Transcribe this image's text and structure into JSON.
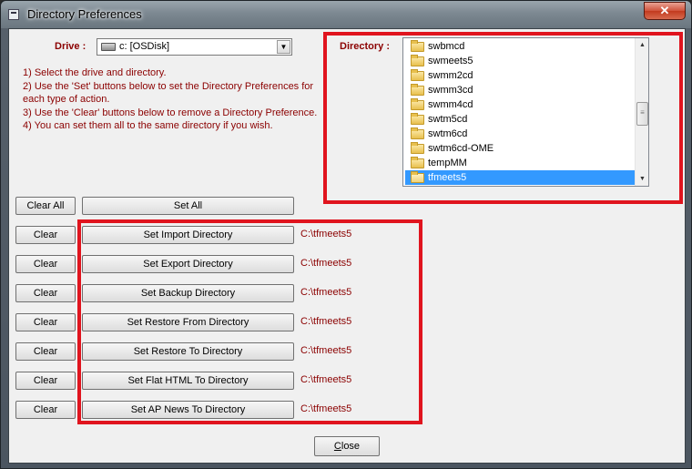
{
  "window": {
    "title": "Directory Preferences",
    "close_glyph": "✕"
  },
  "drive": {
    "label": "Drive :",
    "value": "c: [OSDisk]",
    "icon": "hard-drive-icon"
  },
  "instructions": [
    "1) Select the drive and directory.",
    "2) Use the 'Set' buttons below to set the Directory Preferences for each type of action.",
    "3) Use the 'Clear' buttons below to remove a Directory Preference.",
    "4) You can set them all to the same directory if you wish."
  ],
  "directory": {
    "label": "Directory :",
    "items": [
      "swbmcd",
      "swmeets5",
      "swmm2cd",
      "swmm3cd",
      "swmm4cd",
      "swtm5cd",
      "swtm6cd",
      "swtm6cd-OME",
      "tempMM",
      "tfmeets5"
    ],
    "selected": "tfmeets5"
  },
  "global_actions": {
    "clear_all": "Clear All",
    "set_all": "Set All"
  },
  "rows": [
    {
      "clear": "Clear",
      "set": "Set Import Directory",
      "path": "C:\\tfmeets5"
    },
    {
      "clear": "Clear",
      "set": "Set Export Directory",
      "path": "C:\\tfmeets5"
    },
    {
      "clear": "Clear",
      "set": "Set Backup Directory",
      "path": "C:\\tfmeets5"
    },
    {
      "clear": "Clear",
      "set": "Set Restore From Directory",
      "path": "C:\\tfmeets5"
    },
    {
      "clear": "Clear",
      "set": "Set Restore To Directory",
      "path": "C:\\tfmeets5"
    },
    {
      "clear": "Clear",
      "set": "Set Flat HTML To Directory",
      "path": "C:\\tfmeets5"
    },
    {
      "clear": "Clear",
      "set": "Set AP News To Directory",
      "path": "C:\\tfmeets5"
    }
  ],
  "footer": {
    "close_label_first": "C",
    "close_label_rest": "lose"
  },
  "colors": {
    "label_red": "#8b0000",
    "highlight_red": "#e0141e",
    "selection_blue": "#3399ff"
  }
}
